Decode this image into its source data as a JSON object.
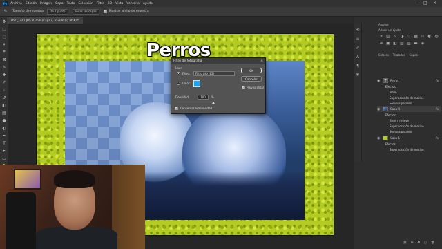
{
  "menubar": {
    "logo": "Ps",
    "items": [
      "Archivo",
      "Edición",
      "Imagen",
      "Capa",
      "Texto",
      "Selección",
      "Filtro",
      "3D",
      "Vista",
      "Ventana",
      "Ayuda"
    ]
  },
  "options": {
    "sample_label": "Tamaño de muestra:",
    "sample_value": "De 1 punto",
    "sample_mode": "Todas las capas",
    "show_ring": "Mostrar anillo de muestra"
  },
  "document": {
    "tab_title": "DSC_1461.JPG al 25% (Capa 4, RGB/8*) (CMYK) *",
    "overlay_title": "Perros"
  },
  "dialog": {
    "title": "Filtro de fotografía",
    "use_label": "Usar",
    "filter_label": "Filtro:",
    "filter_value": "Filtro frío (82)",
    "color_label": "Color:",
    "color_value": "#14a3ff",
    "density_label": "Densidad:",
    "density_value": "100",
    "density_unit": "%",
    "preserve_label": "Conservar luminosidad",
    "ok_label": "OK",
    "cancel_label": "Cancelar",
    "preview_label": "Previsualizar"
  },
  "panels": {
    "top_tabs": [
      "Ajustes"
    ],
    "add_adjustment": "Añadir un ajuste",
    "layer_tabs": [
      "Colores",
      "Trazados",
      "Capas"
    ],
    "layers": [
      {
        "name": "Perros",
        "kind": "text"
      },
      {
        "name": "Efectos"
      },
      {
        "name": "Trazo"
      },
      {
        "name": "Superposición de motivo"
      },
      {
        "name": "Sombra paralela"
      },
      {
        "name": "Capa 4",
        "kind": "image"
      },
      {
        "name": "Efectos"
      },
      {
        "name": "Bisel y relieve"
      },
      {
        "name": "Superposición de motivo"
      },
      {
        "name": "Sombra paralela"
      },
      {
        "name": "Capa 1",
        "kind": "fill"
      },
      {
        "name": "Efectos"
      },
      {
        "name": "Superposición de motivo"
      }
    ]
  },
  "colors": {
    "accent": "#14a3ff",
    "background_pattern": "#b4cc22"
  }
}
